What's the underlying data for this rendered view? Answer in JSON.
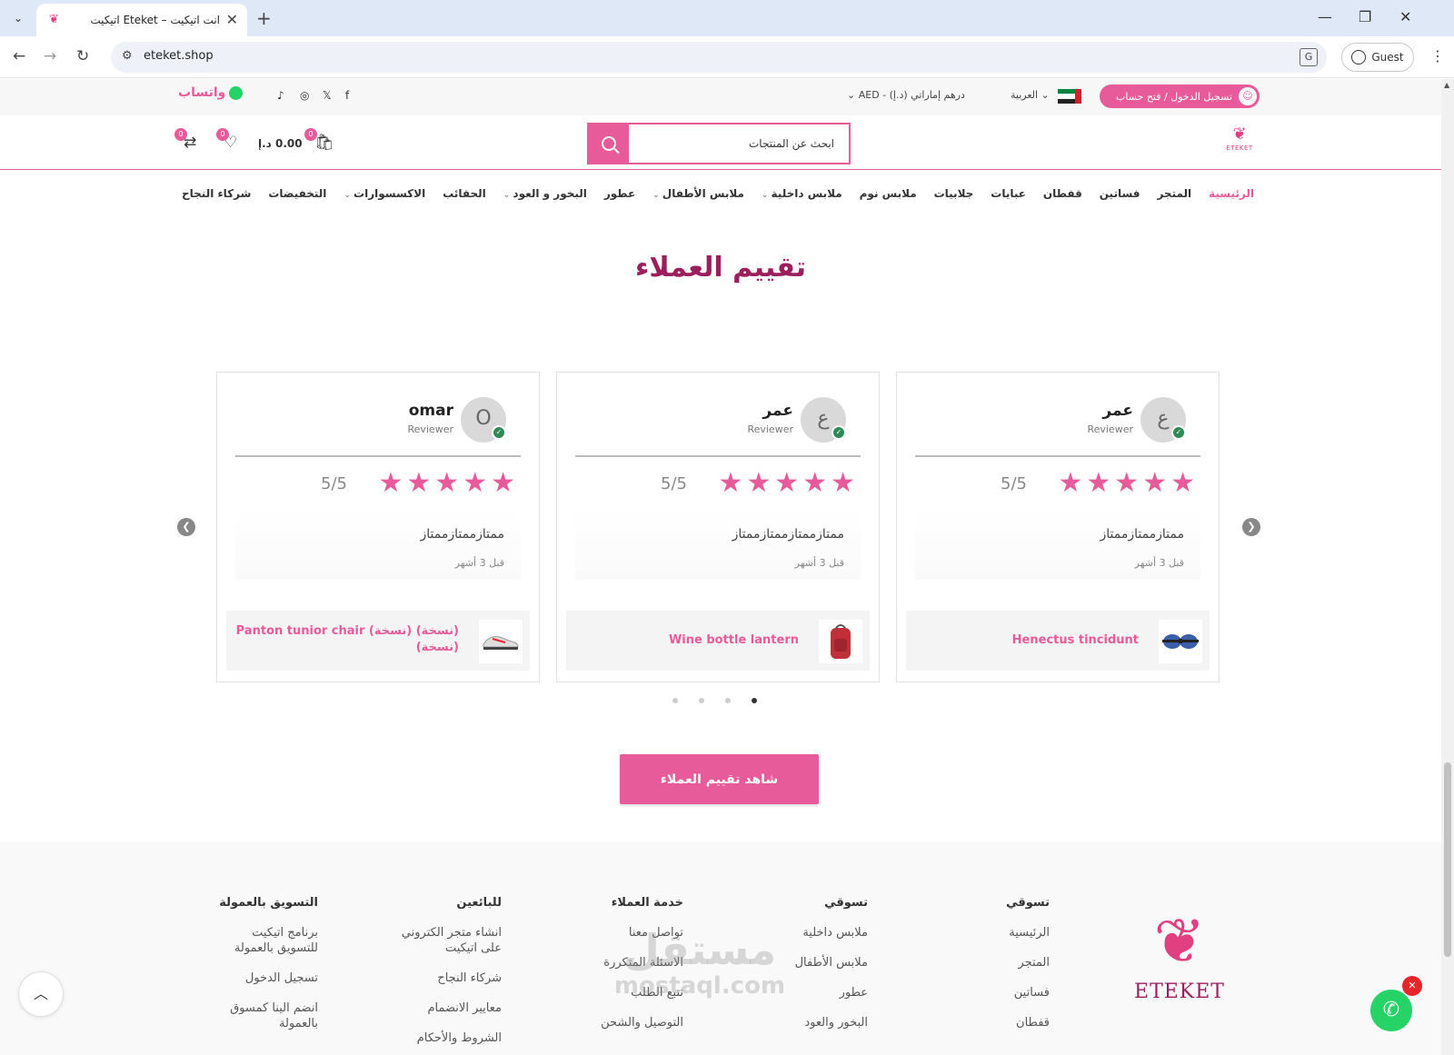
{
  "browser": {
    "tab_title": "اتيكيت Eteket – انت اتيكيت",
    "url": "eteket.shop",
    "profile_label": "Guest"
  },
  "topbar": {
    "login_label": "تسجيل الدخول / فتح حساب",
    "language": "العربية",
    "currency": "درهم إماراتي (د.إ) - AED",
    "whatsapp_label": "واتساب"
  },
  "header": {
    "logo_text": "ETEKET",
    "search_placeholder": "ابحث عن المنتجات",
    "cart_total": "0.00 د.إ",
    "cart_count": "0",
    "wishlist_count": "0",
    "compare_count": "0"
  },
  "nav": {
    "items": [
      {
        "label": "الرئيسية",
        "active": true,
        "dropdown": false
      },
      {
        "label": "المتجر",
        "active": false,
        "dropdown": false
      },
      {
        "label": "فساتين",
        "active": false,
        "dropdown": false
      },
      {
        "label": "قفطان",
        "active": false,
        "dropdown": false
      },
      {
        "label": "عبايات",
        "active": false,
        "dropdown": false
      },
      {
        "label": "جلابيات",
        "active": false,
        "dropdown": false
      },
      {
        "label": "ملابس نوم",
        "active": false,
        "dropdown": false
      },
      {
        "label": "ملابس داخلية",
        "active": false,
        "dropdown": true
      },
      {
        "label": "ملابس الأطفال",
        "active": false,
        "dropdown": true
      },
      {
        "label": "عطور",
        "active": false,
        "dropdown": false
      },
      {
        "label": "البخور و العود",
        "active": false,
        "dropdown": true
      },
      {
        "label": "الحقائب",
        "active": false,
        "dropdown": false
      },
      {
        "label": "الاكسسوارات",
        "active": false,
        "dropdown": true
      },
      {
        "label": "التخفيضات",
        "active": false,
        "dropdown": false
      },
      {
        "label": "شركاء النجاح",
        "active": false,
        "dropdown": false
      }
    ]
  },
  "reviews": {
    "title": "تقييم العملاء",
    "cards": [
      {
        "initial": "ع",
        "name": "عمر",
        "role": "Reviewer",
        "rating": 5,
        "score": "5/5",
        "text": "ممتازممتازممتاز",
        "time": "قبل 3 أشهر",
        "product": "Henectus tincidunt",
        "thumb": "goggles"
      },
      {
        "initial": "ع",
        "name": "عمر",
        "role": "Reviewer",
        "rating": 5,
        "score": "5/5",
        "text": "ممتازممتازممتازممتاز",
        "time": "قبل 3 أشهر",
        "product": "Wine bottle lantern",
        "thumb": "backpack"
      },
      {
        "initial": "O",
        "name": "omar",
        "role": "Reviewer",
        "rating": 5,
        "score": "5/5",
        "text": "ممتازممتازممتاز",
        "time": "قبل 3 أشهر",
        "product": "Panton tunior chair (نسخة) (نسخة) (نسخة)",
        "thumb": "shoe"
      }
    ],
    "dots": 4,
    "active_dot": 4,
    "cta_label": "شاهد تقييم العملاء"
  },
  "footer": {
    "logo_text": "ETEKET",
    "watermark_ar": "مستقل",
    "watermark_lat": "mostaql.com",
    "columns": [
      {
        "title": "تسوقي",
        "links": [
          "الرئيسية",
          "المتجر",
          "فساتين",
          "قفطان"
        ]
      },
      {
        "title": "تسوقي",
        "links": [
          "ملابس داخلية",
          "ملابس الأطفال",
          "عطور",
          "البخور والعود"
        ]
      },
      {
        "title": "خدمة العملاء",
        "links": [
          "تواصل معنا",
          "الاسئلة المتكررة",
          "تتبع الطلب",
          "التوصيل والشحن"
        ]
      },
      {
        "title": "للبائعين",
        "links": [
          "انشاء متجر الكتروني على اتيكيت",
          "شركاء النجاح",
          "معايير الانضمام",
          "الشروط والأحكام"
        ]
      },
      {
        "title": "التسويق بالعمولة",
        "links": [
          "برنامج اتيكيت للتسويق بالعمولة",
          "تسجيل الدخول",
          "انضم الينا كمسوق بالعمولة"
        ]
      }
    ]
  },
  "colors": {
    "brand_pink": "#e75b9a",
    "title_plum": "#9b1f5c",
    "whatsapp_green": "#25d366"
  }
}
